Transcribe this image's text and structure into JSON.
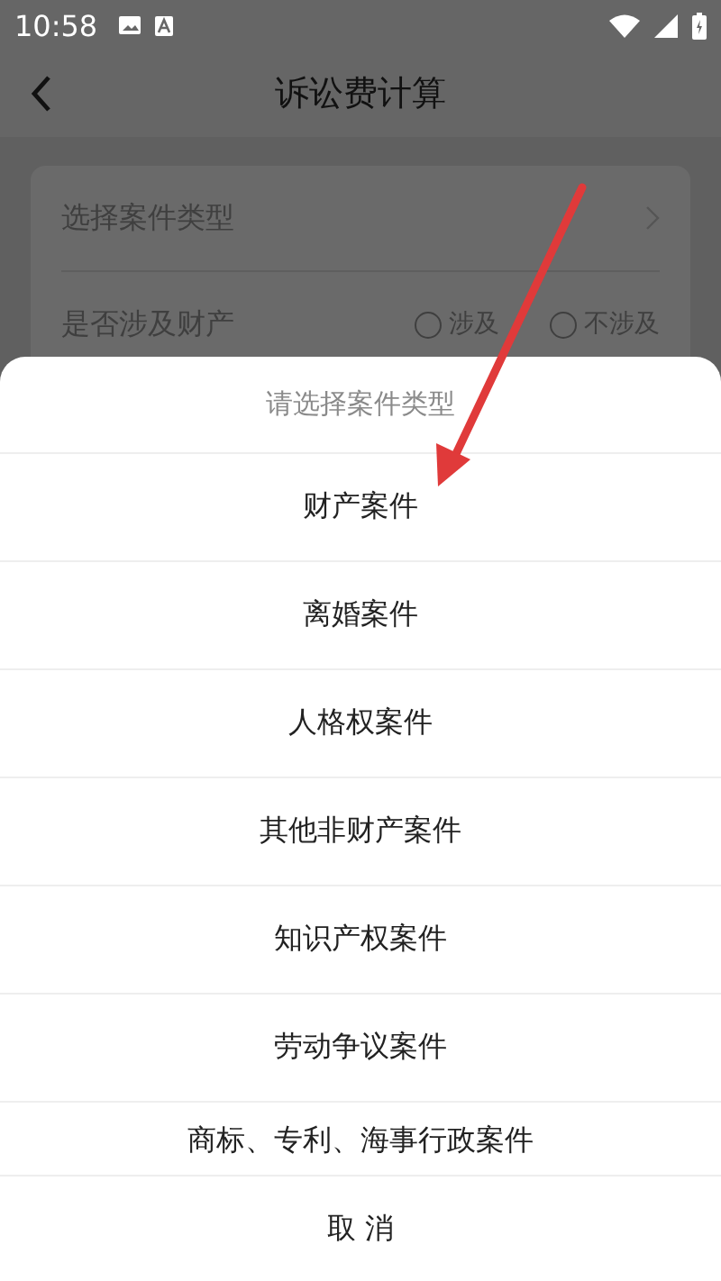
{
  "status_bar": {
    "time": "10:58"
  },
  "header": {
    "title": "诉讼费计算"
  },
  "form": {
    "case_type": {
      "label": "选择案件类型"
    },
    "property": {
      "label": "是否涉及财产",
      "options": [
        {
          "label": "涉及",
          "selected": false
        },
        {
          "label": "不涉及",
          "selected": false
        }
      ]
    }
  },
  "sheet": {
    "title": "请选择案件类型",
    "options": [
      "财产案件",
      "离婚案件",
      "人格权案件",
      "其他非财产案件",
      "知识产权案件",
      "劳动争议案件",
      "商标、专利、海事行政案件"
    ],
    "cancel": "取 消"
  }
}
